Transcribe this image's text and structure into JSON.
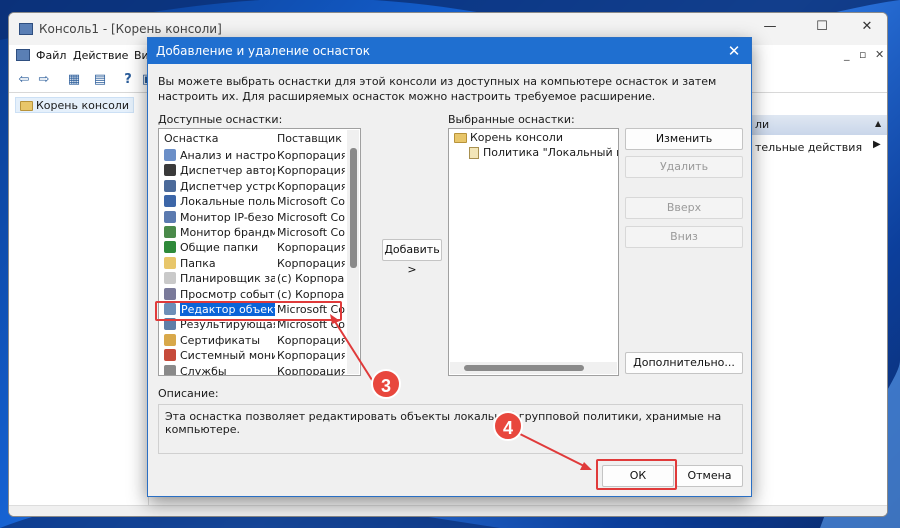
{
  "colors": {
    "accent": "#1f6fd0",
    "selection": "#0a64d8",
    "annotation": "#e8473d"
  },
  "mmc": {
    "title": "Консоль1 - [Корень консоли]",
    "menu": [
      "Файл",
      "Действие",
      "Ви"
    ],
    "tree_root": "Корень консоли",
    "actions_header": "ли",
    "actions_item": "тельные действия"
  },
  "dialog": {
    "title": "Добавление и удаление оснасток",
    "description": "Вы можете выбрать оснастки для этой консоли из доступных на компьютере оснасток и затем настроить их. Для расширяемых оснасток можно настроить требуемое расширение.",
    "available_label": "Доступные оснастки:",
    "selected_label": "Выбранные оснастки:",
    "columns": {
      "snapin": "Оснастка",
      "vendor": "Поставщик"
    },
    "available": [
      {
        "name": "Анализ и настрой...",
        "vendor": "Корпорация...",
        "icon": "analysis-icon"
      },
      {
        "name": "Диспетчер автор...",
        "vendor": "Корпорация...",
        "icon": "authorization-manager-icon"
      },
      {
        "name": "Диспетчер устро...",
        "vendor": "Корпорация...",
        "icon": "device-manager-icon"
      },
      {
        "name": "Локальные польз...",
        "vendor": "Microsoft Co...",
        "icon": "local-users-icon"
      },
      {
        "name": "Монитор IP-безо...",
        "vendor": "Microsoft Co...",
        "icon": "ip-security-monitor-icon"
      },
      {
        "name": "Монитор брандм...",
        "vendor": "Microsoft Co...",
        "icon": "firewall-monitor-icon"
      },
      {
        "name": "Общие папки",
        "vendor": "Корпорация...",
        "icon": "shared-folders-icon"
      },
      {
        "name": "Папка",
        "vendor": "Корпорация...",
        "icon": "folder-icon"
      },
      {
        "name": "Планировщик за...",
        "vendor": "(c) Корпора...",
        "icon": "task-scheduler-icon"
      },
      {
        "name": "Просмотр событий",
        "vendor": "(c) Корпора...",
        "icon": "event-viewer-icon"
      },
      {
        "name": "Редактор объект...",
        "vendor": "Microsoft Co...",
        "icon": "gpo-editor-icon",
        "selected": true
      },
      {
        "name": "Результирующая ...",
        "vendor": "Microsoft Co...",
        "icon": "rsop-icon"
      },
      {
        "name": "Сертификаты",
        "vendor": "Корпорация...",
        "icon": "certificates-icon"
      },
      {
        "name": "Системный монит...",
        "vendor": "Корпорация...",
        "icon": "system-monitor-icon"
      },
      {
        "name": "Службы",
        "vendor": "Корпорация...",
        "icon": "services-icon"
      }
    ],
    "selected_tree": {
      "root": "Корень консоли",
      "child": "Политика \"Локальный компью"
    },
    "buttons": {
      "add": "Добавить >",
      "edit_extensions": "Изменить расширения...",
      "remove": "Удалить",
      "up": "Вверх",
      "down": "Вниз",
      "advanced": "Дополнительно...",
      "ok": "ОК",
      "cancel": "Отмена"
    },
    "description_label": "Описание:",
    "description_text": "Эта оснастка позволяет редактировать объекты локальной групповой политики, хранимые на компьютере."
  },
  "annotations": {
    "step3": "3",
    "step4": "4"
  }
}
